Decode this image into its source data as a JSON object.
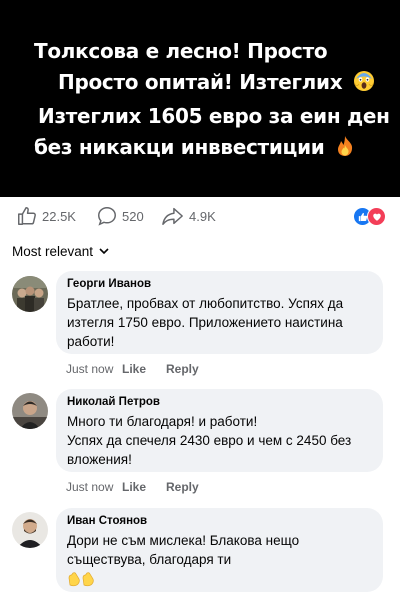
{
  "banner": {
    "line1": "Толксова е лесно! Просто",
    "line2": "Просто опитай! Изтеглих",
    "line3": "Изтеглих 1605 евро за еин ден",
    "line4": "без никакци инввестиции",
    "line2_emoji": "scream-emoji-icon",
    "line4_emoji": "fire-emoji-icon"
  },
  "stats": {
    "likes": "22.5K",
    "comments": "520",
    "shares": "4.9K"
  },
  "sort": {
    "label": "Most relevant"
  },
  "colors": {
    "accent": "#1877f2",
    "love": "#f33e58",
    "bubble": "#f0f2f5",
    "muted": "#65676b"
  },
  "comments": [
    {
      "author": "Георги Иванов",
      "text": "Братлее, пробвах от любопитство. Успях да изтегля 1750 евро. Приложението наистина работи!",
      "time": "Just now",
      "like": "Like",
      "reply": "Reply"
    },
    {
      "author": "Николай Петров",
      "text_line1": "Много ти благодаря! и работи!",
      "text_line2": "Успях да спечеля 2430 евро и чем с 2450 без вложения!",
      "time": "Just now",
      "like": "Like",
      "reply": "Reply"
    },
    {
      "author": "Иван Стоянов",
      "text": "Дори не съм мислека! Блакова нещо съществува, благодаря ти",
      "emoji": "clapping-hands-icon"
    }
  ]
}
